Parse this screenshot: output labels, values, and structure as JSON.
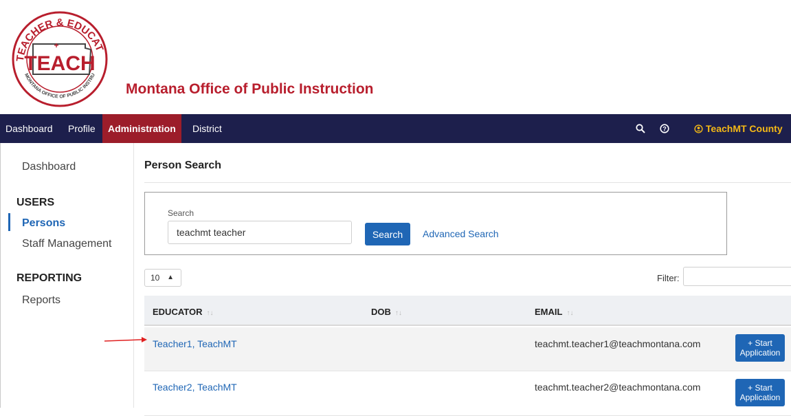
{
  "header": {
    "org_name": "Montana Office of Public Instruction",
    "logo": {
      "main": "TEACH",
      "ring_top": "TEACHER & EDUCATIONAL LEADERS",
      "ring_bottom": "MONTANA OFFICE OF PUBLIC INSTRUCTION"
    }
  },
  "nav": {
    "items": [
      {
        "label": "Dashboard"
      },
      {
        "label": "Profile"
      },
      {
        "label": "Administration",
        "active": true
      },
      {
        "label": "District"
      }
    ],
    "icons": [
      "search-icon",
      "help-icon",
      "user-circle-icon"
    ],
    "user_label": "TeachMT County"
  },
  "sidebar": {
    "dashboard": "Dashboard",
    "users_heading": "USERS",
    "persons": "Persons",
    "staff_management": "Staff Management",
    "reporting_heading": "REPORTING",
    "reports": "Reports"
  },
  "main": {
    "title": "Person Search",
    "search": {
      "label": "Search",
      "value": "teachmt teacher",
      "button": "Search",
      "advanced": "Advanced Search"
    },
    "page_size": "10",
    "filter_label": "Filter:",
    "table": {
      "headers": [
        "EDUCATOR",
        "DOB",
        "EMAIL"
      ],
      "rows": [
        {
          "educator": "Teacher1, TeachMT",
          "dob": "",
          "email": "teachmt.teacher1@teachmontana.com",
          "action": "+ Start Application"
        },
        {
          "educator": "Teacher2, TeachMT",
          "dob": "",
          "email": "teachmt.teacher2@teachmontana.com",
          "action": "+ Start Application"
        }
      ]
    }
  },
  "colors": {
    "nav_bg": "#1d1f4c",
    "nav_active": "#9c1d2a",
    "user_accent": "#f5b916",
    "brand_red": "#b81e2d",
    "link_blue": "#1f66b5"
  }
}
